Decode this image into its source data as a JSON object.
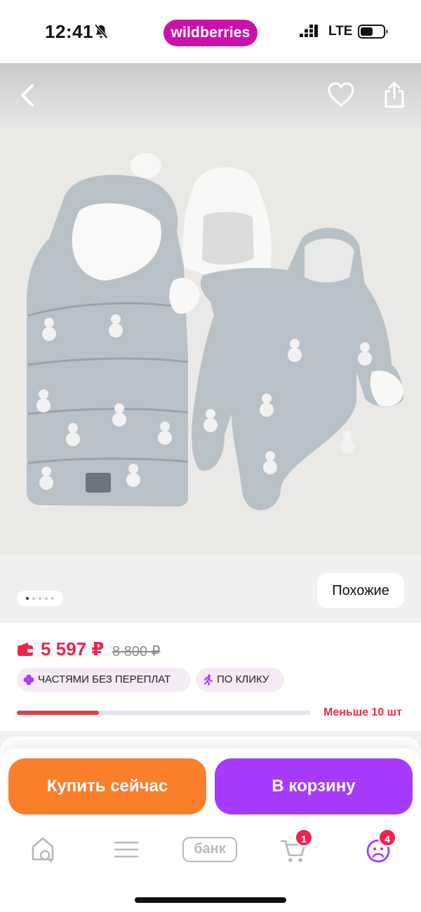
{
  "status_bar": {
    "time": "12:41",
    "brand": "wildberries",
    "network": "LTE"
  },
  "product_image": {
    "similar_label": "Похожие",
    "page_count": 5,
    "current_page": 1
  },
  "price": {
    "current": "5 597 ₽",
    "old": "8 800 ₽",
    "accent": "#f0234b"
  },
  "tags": [
    {
      "label": "ЧАСТЯМИ БЕЗ ПЕРЕПЛАТ",
      "icon": "installment-icon"
    },
    {
      "label": "ПО КЛИКУ",
      "icon": "running-man-icon"
    }
  ],
  "stock": {
    "label": "Меньше 10 шт",
    "level": 0.28
  },
  "actions": {
    "buy_now": "Купить сейчас",
    "add_to_cart": "В корзину",
    "buy_color": "#fb7e2b",
    "cart_color": "#a73afd"
  },
  "tabbar": {
    "items": [
      {
        "name": "home",
        "icon": "home-search-icon"
      },
      {
        "name": "catalog",
        "icon": "menu-icon"
      },
      {
        "name": "bank",
        "label": "банк"
      },
      {
        "name": "cart",
        "icon": "cart-icon",
        "badge": "1"
      },
      {
        "name": "profile",
        "icon": "profile-icon",
        "badge": "4"
      }
    ]
  }
}
